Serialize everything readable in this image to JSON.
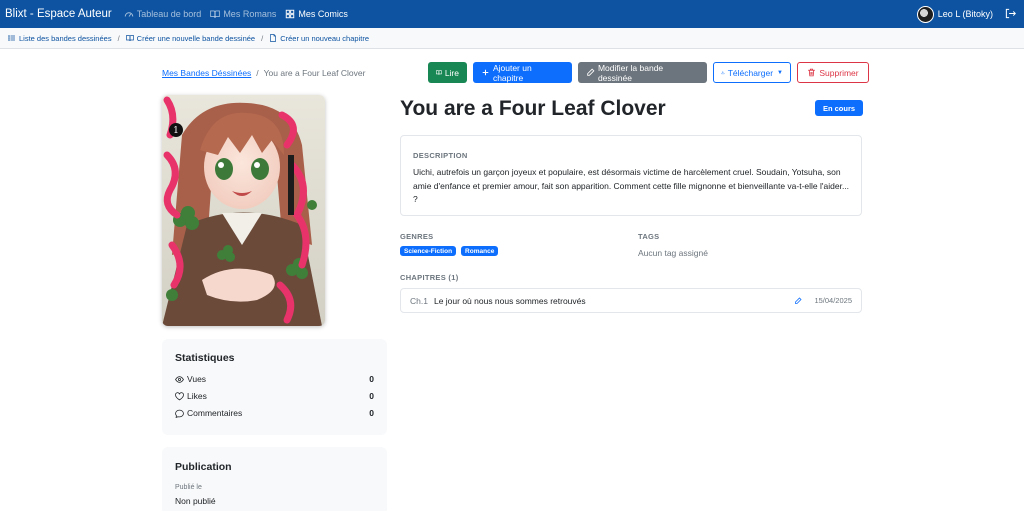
{
  "navbar": {
    "brand": "Blixt - Espace Auteur",
    "links": [
      {
        "label": "Tableau de bord",
        "icon": "speedometer-icon"
      },
      {
        "label": "Mes Romans",
        "icon": "book-icon"
      },
      {
        "label": "Mes Comics",
        "icon": "grid-icon"
      }
    ],
    "user": "Leo L (Bitoky)"
  },
  "subnav": {
    "links": [
      {
        "label": "Liste des bandes dessinées",
        "icon": "list-icon"
      },
      {
        "label": "Créer une nouvelle bande dessinée",
        "icon": "book-icon"
      },
      {
        "label": "Créer un nouveau chapitre",
        "icon": "file-icon"
      }
    ]
  },
  "breadcrumb": {
    "parent": "Mes Bandes Déssinées",
    "current": "You are a Four Leaf Clover"
  },
  "actions": {
    "read": "Lire",
    "add_chapter": "Ajouter un chapitre",
    "edit": "Modifier la bande dessinée",
    "download": "Télécharger",
    "delete": "Supprimer"
  },
  "comic": {
    "title": "You are a Four Leaf Clover",
    "status": "En cours",
    "description_label": "DESCRIPTION",
    "description": "Uichi, autrefois un garçon joyeux et populaire, est désormais victime de harcèlement cruel. Soudain, Yotsuha, son amie d'enfance et premier amour, fait son apparition. Comment cette fille mignonne et bienveillante va-t-elle l'aider... ?",
    "genres_label": "GENRES",
    "genres": [
      "Science-Fiction",
      "Romance"
    ],
    "tags_label": "TAGS",
    "tags_empty": "Aucun tag assigné",
    "chapters_label": "CHAPITRES (1)",
    "chapters": [
      {
        "number": "Ch.1",
        "title": "Le jour où nous nous sommes retrouvés",
        "date": "15/04/2025"
      }
    ]
  },
  "stats": {
    "title": "Statistiques",
    "rows": [
      {
        "label": "Vues",
        "value": "0",
        "icon": "eye-icon"
      },
      {
        "label": "Likes",
        "value": "0",
        "icon": "heart-icon"
      },
      {
        "label": "Commentaires",
        "value": "0",
        "icon": "chat-icon"
      }
    ]
  },
  "publication": {
    "title": "Publication",
    "label": "Publié le",
    "value": "Non publié"
  },
  "colors": {
    "navbar": "#0d53a1",
    "primary": "#0d6efd",
    "success": "#198754",
    "secondary": "#6c757d",
    "danger": "#dc3545"
  }
}
